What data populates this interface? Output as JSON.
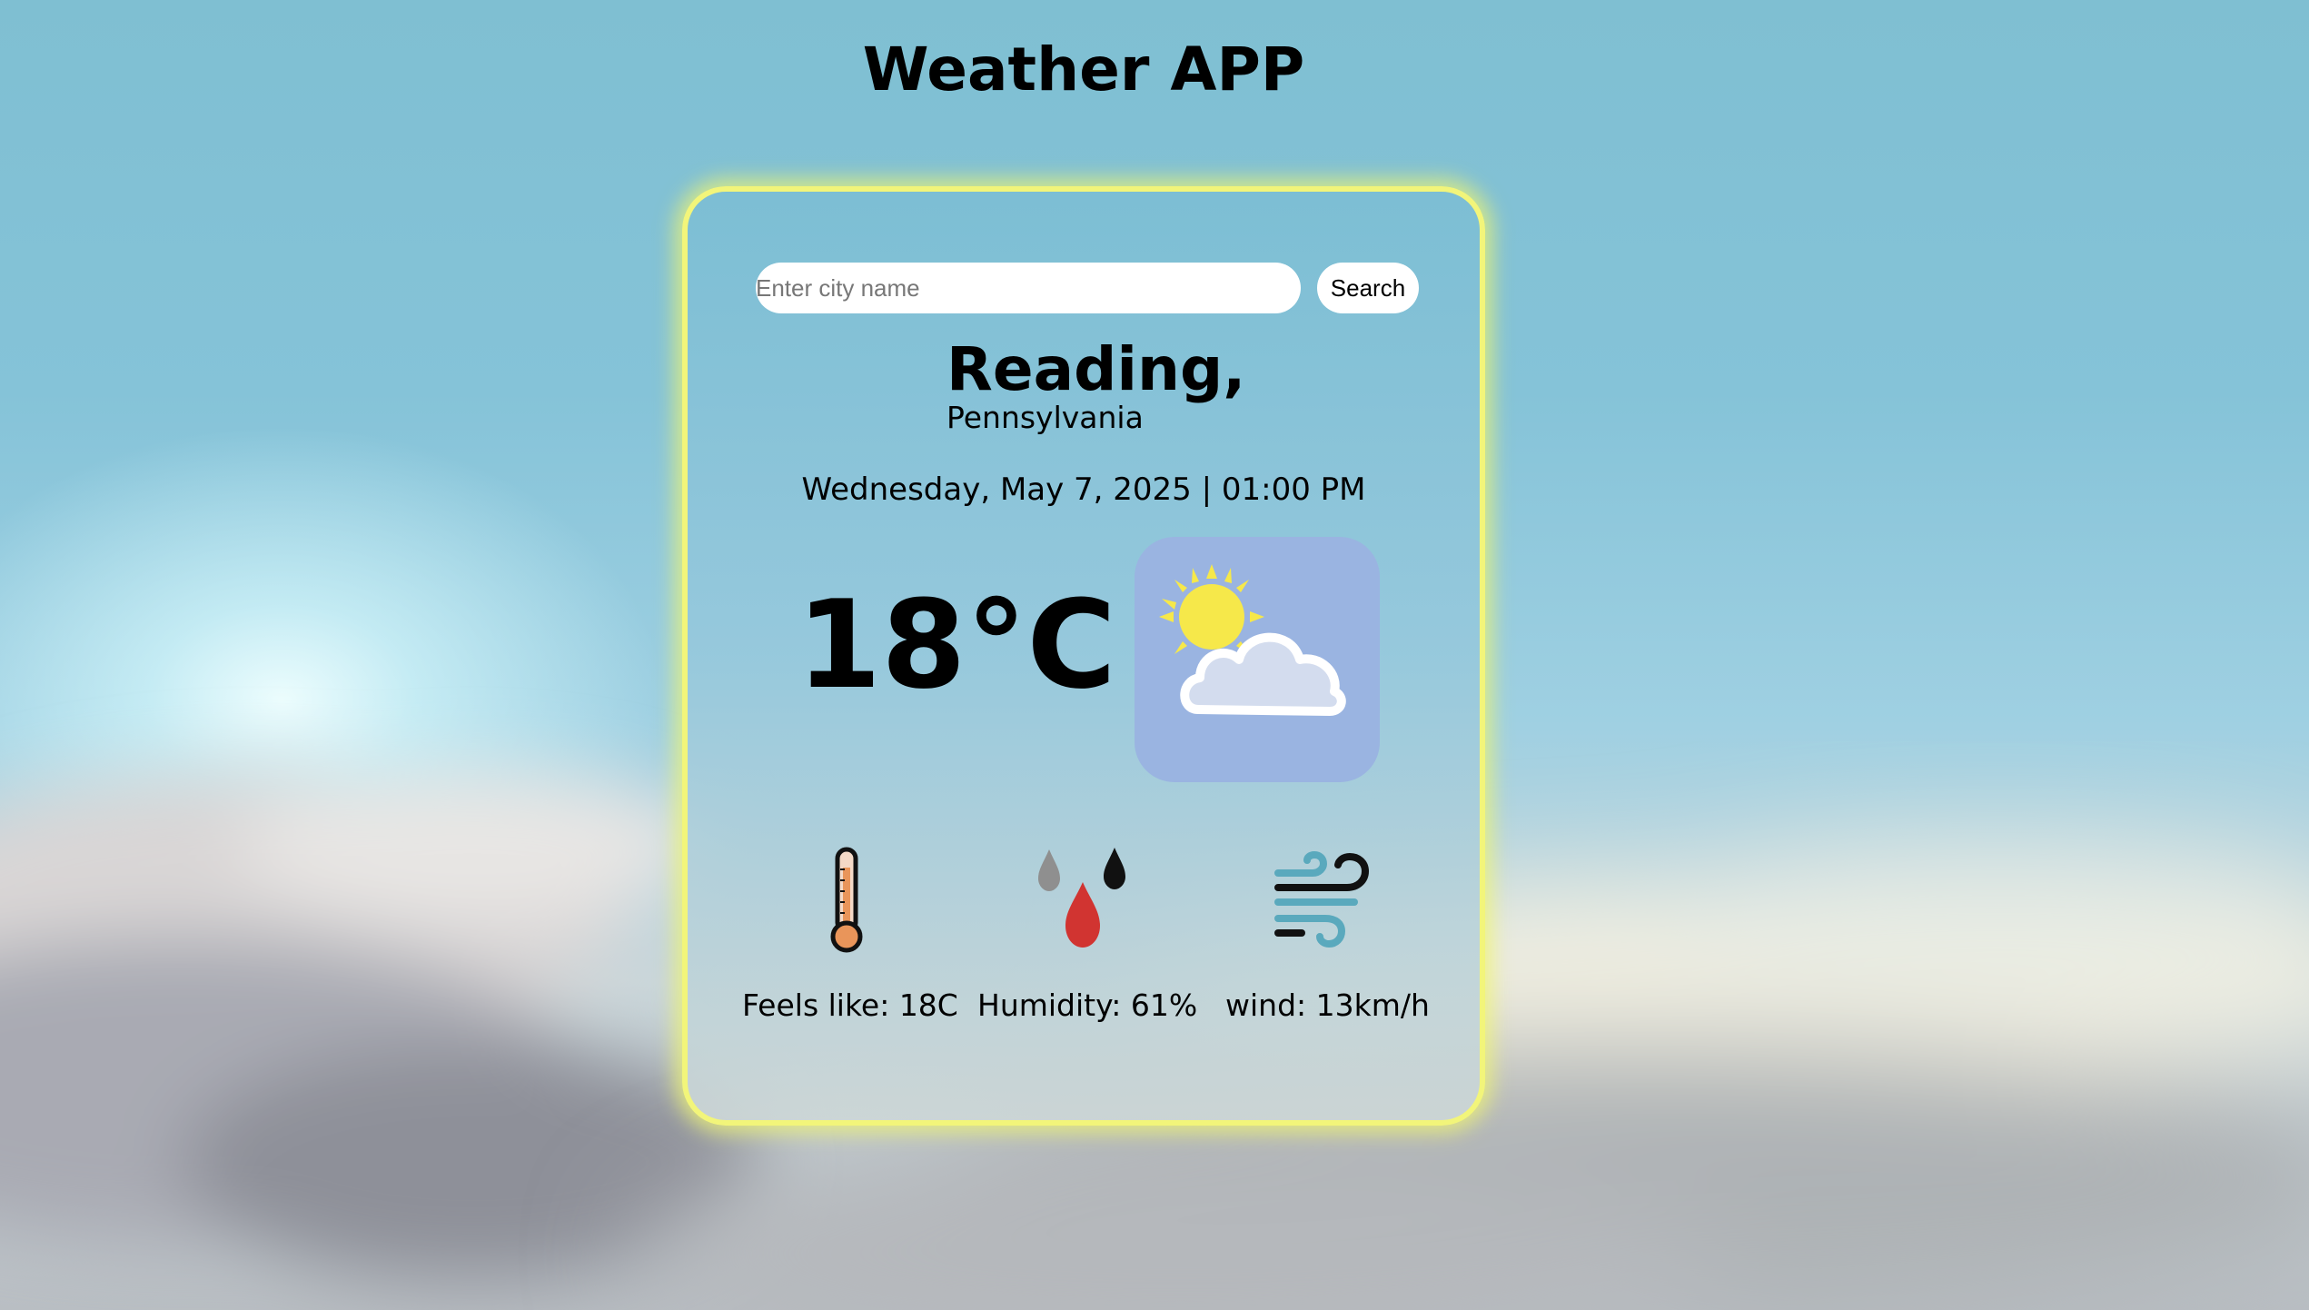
{
  "header": {
    "title": "Weather APP"
  },
  "search": {
    "placeholder": "Enter city name",
    "value": "",
    "button_label": "Search"
  },
  "location": {
    "city": "Reading,",
    "region": "Pennsylvania"
  },
  "datetime": "Wednesday, May 7, 2025 | 01:00 PM",
  "current": {
    "temperature": "18°C",
    "condition_icon": "partly-cloudy-icon"
  },
  "details": {
    "feels_like": {
      "label": "Feels like: 18C",
      "icon": "thermometer-icon"
    },
    "humidity": {
      "label": "Humidity: 61%",
      "icon": "humidity-icon"
    },
    "wind": {
      "label": "wind: 13km/h",
      "icon": "wind-icon"
    }
  },
  "colors": {
    "card_border": "#f2f57a",
    "icon_tile": "#9ab4e1",
    "sun": "#f6e84a",
    "drop_red": "#d13431",
    "wind_teal": "#5aa9bd",
    "thermo_orange": "#e9955a"
  }
}
